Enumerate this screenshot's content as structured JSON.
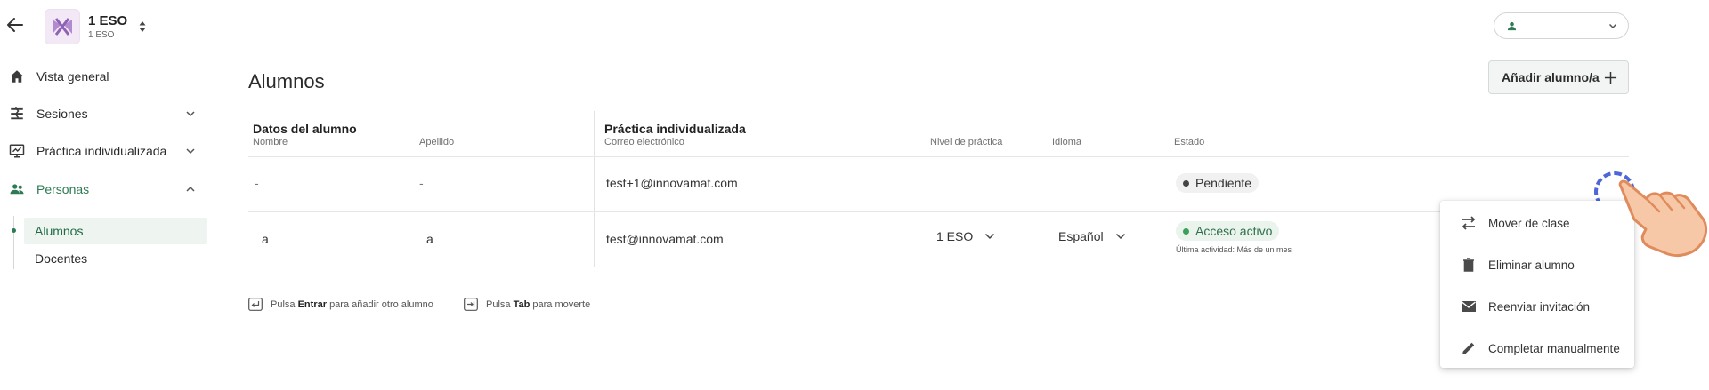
{
  "header": {
    "class_title": "1 ESO",
    "class_subtitle": "1 ESO",
    "user_name": ""
  },
  "sidebar": {
    "items": [
      {
        "label": "Vista general",
        "icon": "home-icon"
      },
      {
        "label": "Sesiones",
        "icon": "sessions-icon"
      },
      {
        "label": "Práctica individualizada",
        "icon": "practice-icon"
      },
      {
        "label": "Personas",
        "icon": "people-icon"
      }
    ],
    "subitems": [
      {
        "label": "Alumnos"
      },
      {
        "label": "Docentes"
      }
    ]
  },
  "main": {
    "title": "Alumnos",
    "add_button": "Añadir alumno/a"
  },
  "table": {
    "groups": [
      "Datos del alumno",
      "Práctica individualizada"
    ],
    "columns": [
      "Nombre",
      "Apellido",
      "Correo electrónico",
      "Nivel de práctica",
      "Idioma",
      "Estado"
    ],
    "rows": [
      {
        "nombre": "-",
        "apellido": "-",
        "correo": "test+1@innovamat.com",
        "nivel": "",
        "idioma": "",
        "estado": "Pendiente",
        "actividad": ""
      },
      {
        "nombre": "a",
        "apellido": "a",
        "correo": "test@innovamat.com",
        "nivel": "1 ESO",
        "idioma": "Español",
        "estado": "Acceso activo",
        "actividad": "Última actividad: Más de un mes"
      }
    ]
  },
  "hints": {
    "enter_prefix": "Pulsa ",
    "enter_key": "Entrar",
    "enter_suffix": " para añadir otro alumno",
    "tab_prefix": "Pulsa ",
    "tab_key": "Tab",
    "tab_suffix": " para moverte"
  },
  "context_menu": {
    "items": [
      {
        "label": "Mover de clase",
        "icon": "swap-icon"
      },
      {
        "label": "Eliminar alumno",
        "icon": "trash-icon"
      },
      {
        "label": "Reenviar invitación",
        "icon": "mail-icon"
      },
      {
        "label": "Completar manualmente",
        "icon": "pencil-icon"
      }
    ]
  },
  "colors": {
    "accent": "#2d7a54",
    "pending_dot": "#444444",
    "active_dot": "#3aa05a",
    "highlight_ring": "#4d66d8"
  }
}
